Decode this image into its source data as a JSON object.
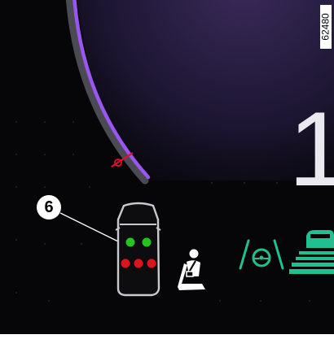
{
  "reference_id": "62480",
  "speed_display": "1",
  "callout_number": "6",
  "seat_indicator": {
    "front_row": [
      "belted",
      "belted"
    ],
    "rear_row": [
      "unbelted",
      "unbelted",
      "unbelted"
    ]
  },
  "icons": {
    "car_top_view": "car-top-view-icon",
    "seatbelt": "seatbelt-warning-icon",
    "lane_assist": "lane-keeping-assist-icon",
    "vehicle_ahead": "vehicle-distance-icon",
    "speed_marker": "speed-marker-icon"
  },
  "colors": {
    "background": "#060608",
    "gauge_arc": "#9b55f0",
    "belted": "#22c41e",
    "unbelted": "#e2121c",
    "driver_assist": "#20c090",
    "marker": "#e0102a"
  }
}
